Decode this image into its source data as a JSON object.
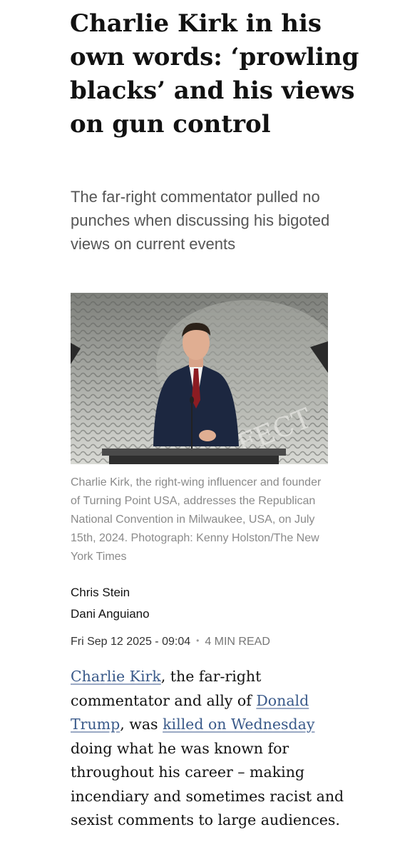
{
  "article": {
    "headline": "Charlie Kirk in his own words: ‘prowling blacks’ and his views on gun control",
    "standfirst": "The far-right commentator pulled no punches when discussing his bigoted views on current events",
    "caption": "Charlie Kirk, the right-wing influencer and founder of Turning Point USA, addresses the Republican National Convention in Milwaukee, USA, on July 15th, 2024. Photograph: Kenny Holston/The New York Times",
    "authors": [
      "Chris Stein",
      "Dani Anguiano"
    ],
    "date": "Fri Sep 12 2025 - 09:04",
    "separator": "•",
    "read_time": "4 MIN READ",
    "body": {
      "link_kirk": "Charlie Kirk",
      "text_1": ", the far-right commentator and ally of ",
      "link_trump": "Donald Trump",
      "text_2": ", was ",
      "link_killed": "killed on Wednesday",
      "text_3": " doing what he was known for throughout his career – making incendiary and sometimes racist and sexist comments to large audiences."
    }
  },
  "colors": {
    "link": "#3a5a8a",
    "standfirst": "#555555",
    "caption": "#8a8a8a"
  }
}
